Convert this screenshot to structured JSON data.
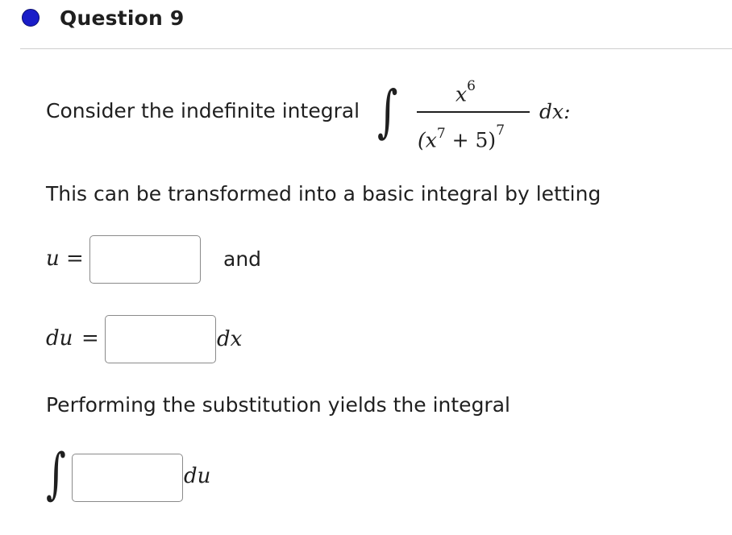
{
  "question": {
    "title": "Question 9",
    "indicator_color": "#1a1dc8"
  },
  "prompt": {
    "intro": "Consider the indefinite integral",
    "integral_sign": "∫",
    "numerator": "x",
    "numerator_exp": "6",
    "denominator": "(x",
    "denominator_inner_exp": "7",
    "denominator_tail": " + 5)",
    "denominator_exp": "7",
    "differential": "dx:",
    "transform_text": "This can be transformed into a basic integral by letting",
    "substitution_text": "Performing the substitution yields the integral"
  },
  "u_row": {
    "var": "u",
    "equals": "=",
    "input_value": "",
    "suffix": "and"
  },
  "du_row": {
    "var": "du",
    "equals": "=",
    "input_value": "",
    "suffix": "dx"
  },
  "final_row": {
    "integral_sign": "∫",
    "input_value": "",
    "suffix": "du"
  }
}
